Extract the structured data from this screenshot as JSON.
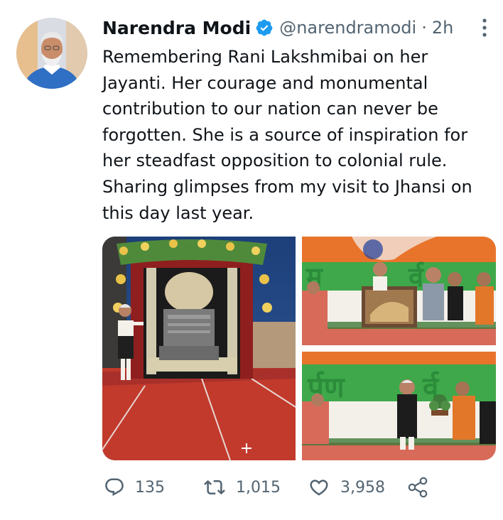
{
  "author": {
    "name": "Narendra Modi",
    "handle": "@narendramodi",
    "separator": "·",
    "time": "2h",
    "verified": true
  },
  "tweet": {
    "text": "Remembering Rani Lakshmibai on her\nJayanti. Her courage and monumental\ncontribution to our nation can never be\nforgotten. She is a source of inspiration for\nher steadfast opposition to colonial rule.\nSharing glimpses from my visit to Jhansi on\nthis day last year."
  },
  "media": {
    "photo_count": 3
  },
  "actions": {
    "replies": "135",
    "retweets": "1,015",
    "likes": "3,958"
  },
  "colors": {
    "text_primary": "#0f1419",
    "text_secondary": "#536471",
    "verified_blue": "#1d9bf0"
  },
  "icons": {
    "verified": "verified-badge-icon",
    "more": "more-vertical-icon",
    "reply": "reply-icon",
    "retweet": "retweet-icon",
    "like": "heart-icon",
    "share": "share-icon"
  }
}
